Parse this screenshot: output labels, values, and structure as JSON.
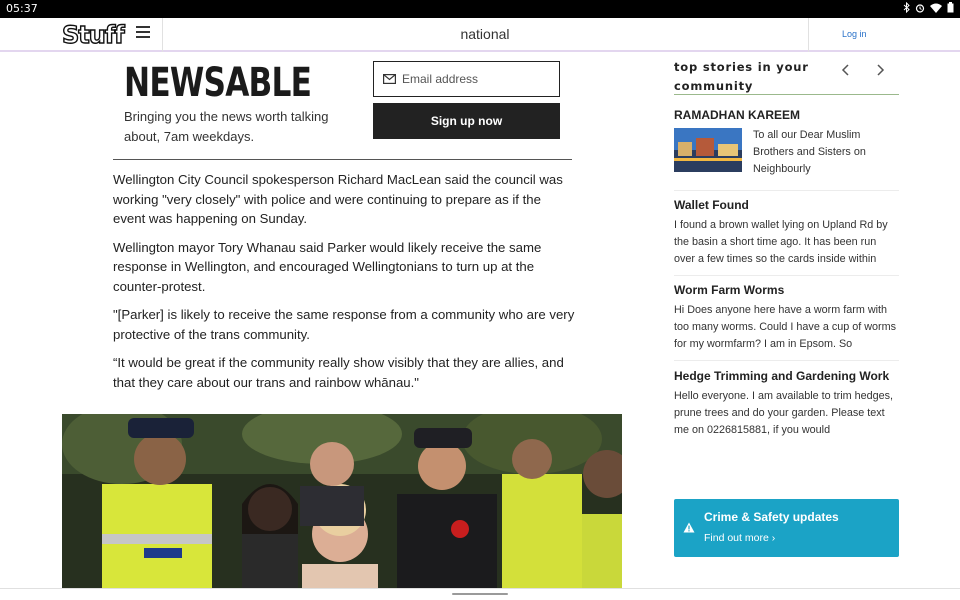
{
  "status_bar": {
    "time": "05:37"
  },
  "header": {
    "logo": "Stuff",
    "section": "national",
    "login_label": "Log in"
  },
  "newsletter": {
    "logo": "NEWSABLE",
    "description": "Bringing you the news worth talking about, 7am weekdays.",
    "email_placeholder": "Email address",
    "signup_label": "Sign up now"
  },
  "article": {
    "paragraphs": [
      "Wellington City Council spokesperson Richard MacLean said the council was working \"very closely\" with police and were continuing to prepare as if the event was happening on Sunday.",
      "Wellington mayor Tory Whanau said Parker would likely receive the same response in Wellington, and encouraged Wellingtonians to turn up at the counter-protest.",
      "\"[Parker] is likely to receive the same response from a community who are very protective of the trans community.",
      "“It would be great if the community really show visibly that they are allies, and that they care about our trans and rainbow whānau.\""
    ]
  },
  "sidebar": {
    "title": "top stories in your community",
    "stories": [
      {
        "title": "RAMADHAN KAREEM",
        "text": "To all our Dear Muslim Brothers and Sisters on Neighbourly"
      },
      {
        "title": "Wallet Found",
        "text": "I found a brown wallet lying on Upland Rd by the basin a short time ago. It has been run over a few times so the cards inside within"
      },
      {
        "title": "Worm Farm Worms",
        "text": "Hi Does anyone here have a worm farm with too many worms. Could I have a cup of worms for my wormfarm? I am in Epsom. So"
      },
      {
        "title": "Hedge Trimming and Gardening Work",
        "text": "Hello everyone. I am available to trim hedges, prune trees and do your garden. Please text me on 0226815881, if you would"
      }
    ],
    "crime_banner": {
      "title": "Crime & Safety updates",
      "link": "Find out more ›"
    }
  },
  "colors": {
    "brand_accent": "#e3d6ef",
    "banner": "#1ba3c6",
    "link": "#2a72c9"
  }
}
